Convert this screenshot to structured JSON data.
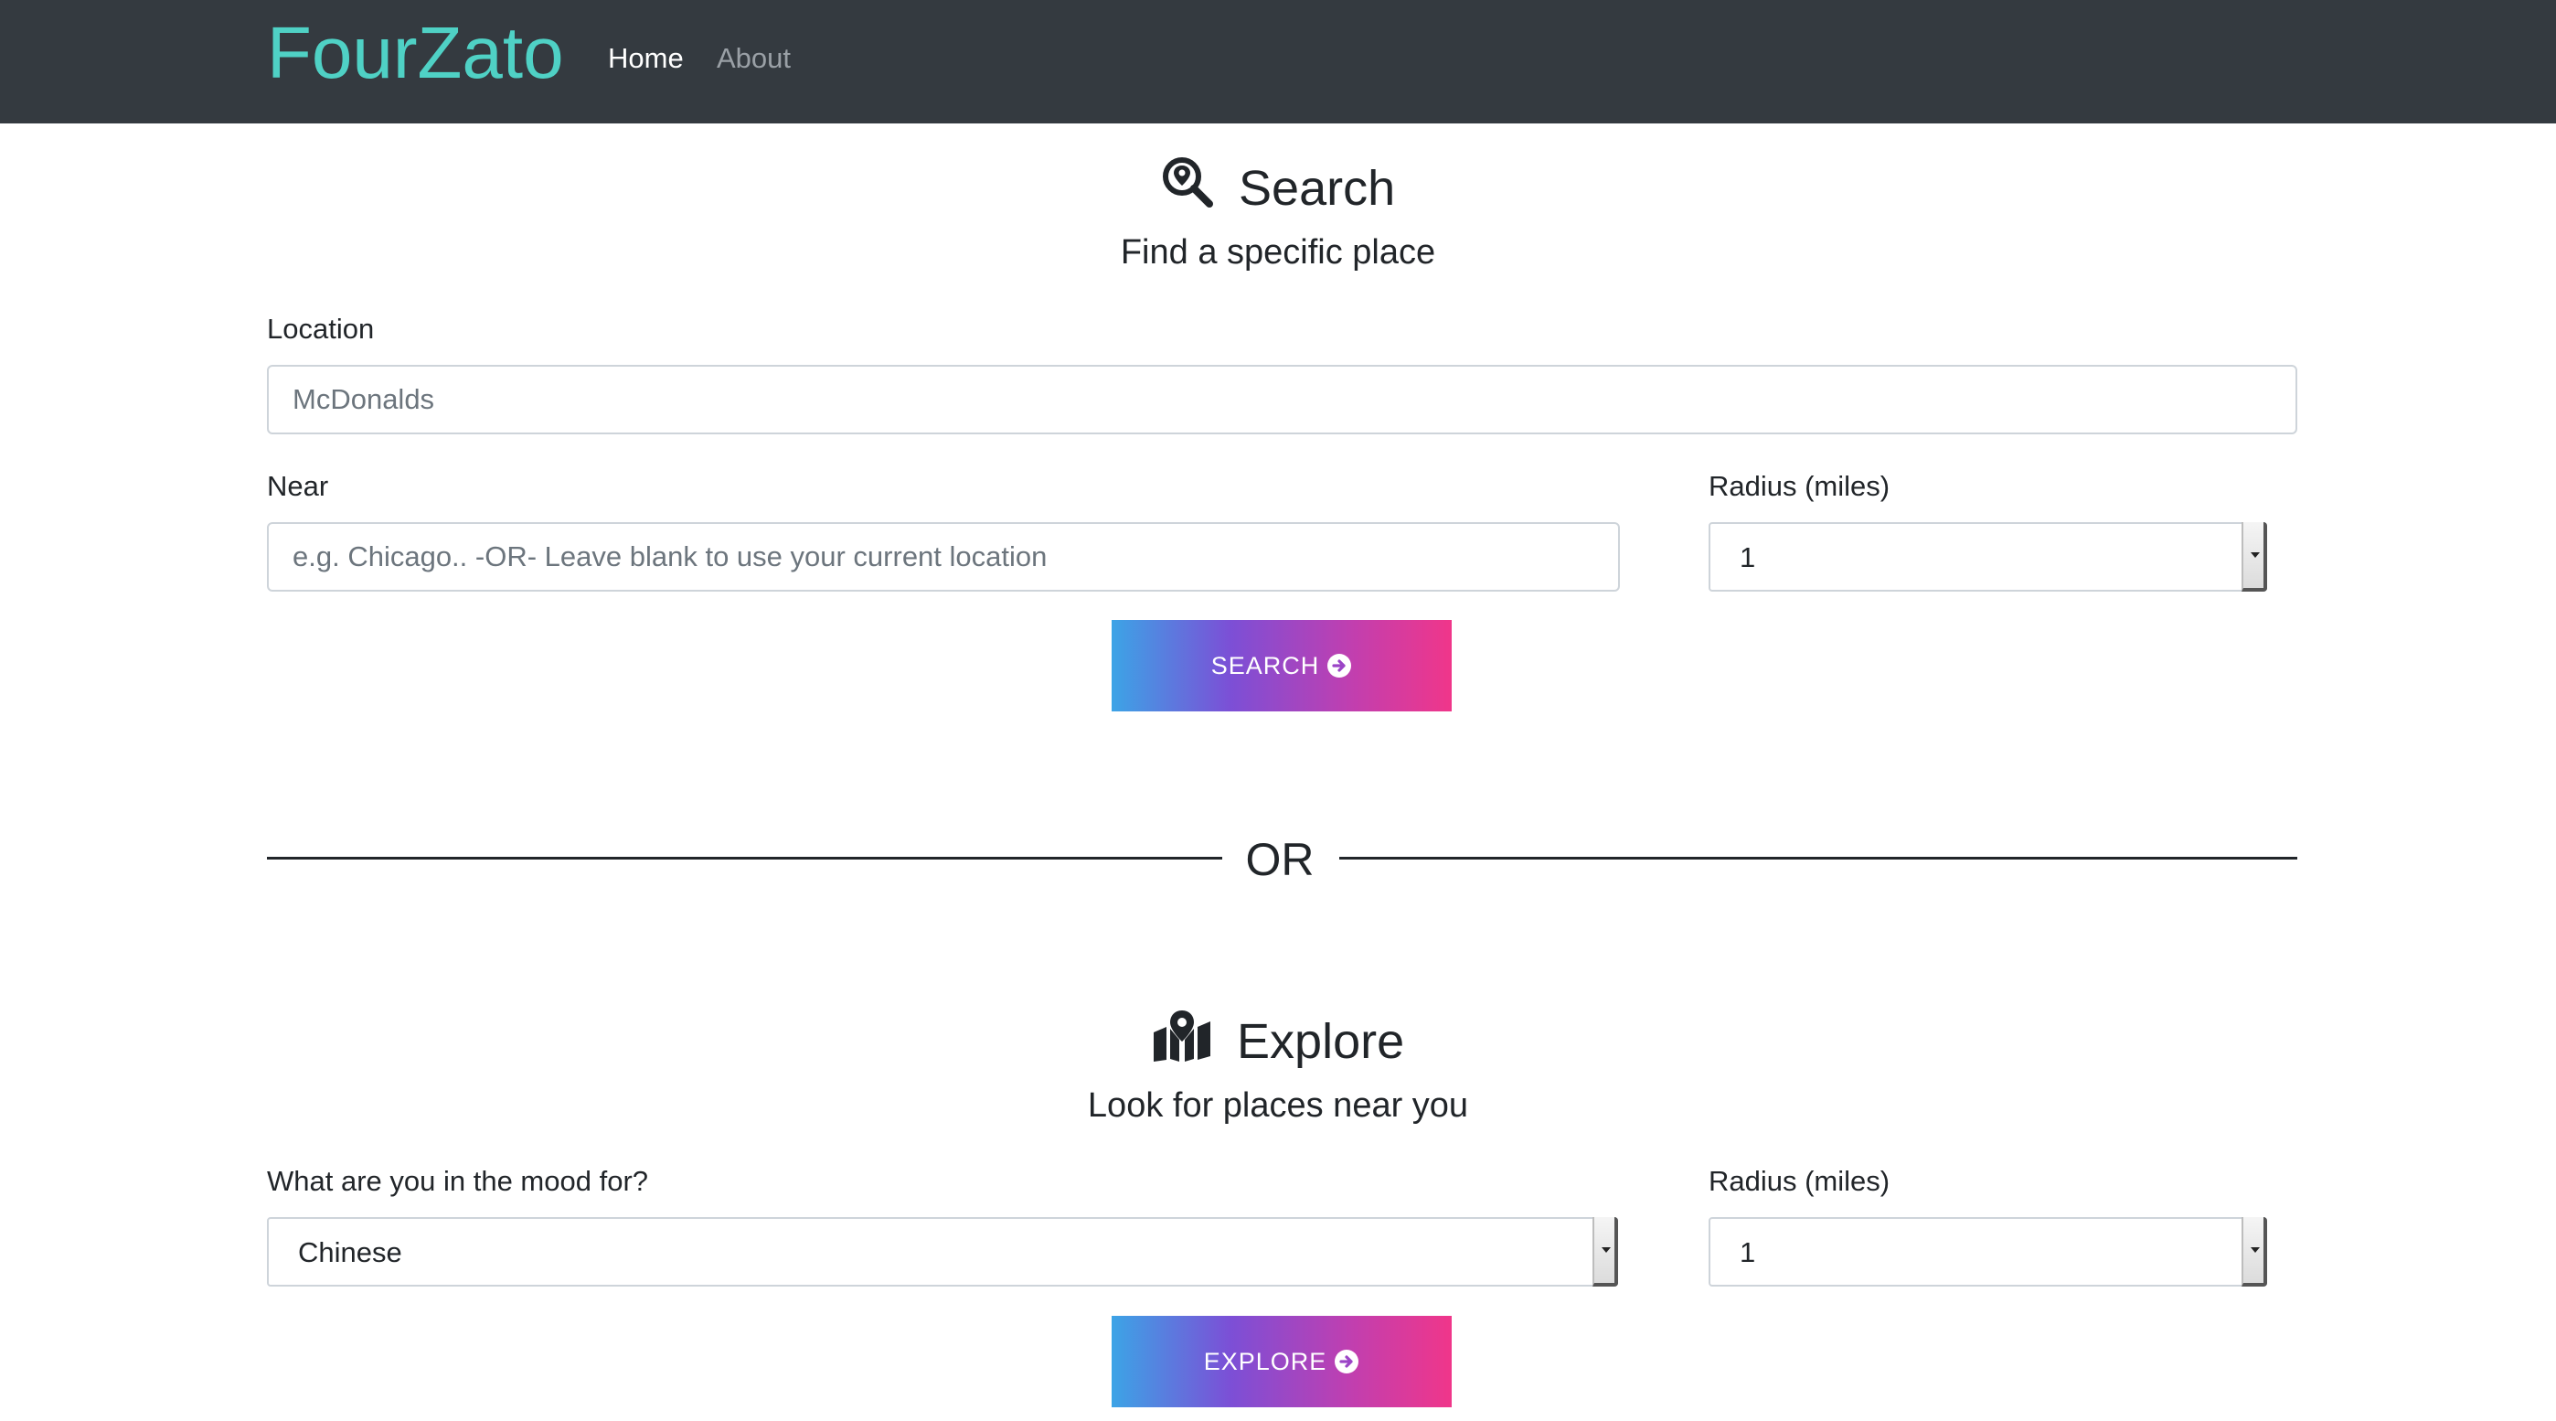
{
  "nav": {
    "brand": "FourZato",
    "links": [
      {
        "label": "Home"
      },
      {
        "label": "About"
      }
    ]
  },
  "search": {
    "title": "Search",
    "subtitle": "Find a specific place",
    "location_label": "Location",
    "location_placeholder": "McDonalds",
    "near_label": "Near",
    "near_placeholder": "e.g. Chicago.. -OR- Leave blank to use your current location",
    "radius_label": "Radius (miles)",
    "radius_value": "1",
    "button_label": "SEARCH"
  },
  "divider": {
    "label": "OR"
  },
  "explore": {
    "title": "Explore",
    "subtitle": "Look for places near you",
    "mood_label": "What are you in the mood for?",
    "mood_value": "Chinese",
    "radius_label": "Radius (miles)",
    "radius_value": "1",
    "button_label": "EXPLORE"
  },
  "colors": {
    "navbar_bg": "#343a40",
    "brand": "#4fd1c5",
    "button_gradient_start": "#3ca4e6",
    "button_gradient_end": "#f0368a"
  },
  "icons": {
    "search_title_icon": "search-location-icon",
    "explore_title_icon": "map-marked-icon",
    "button_icon": "arrow-circle-right-icon"
  }
}
